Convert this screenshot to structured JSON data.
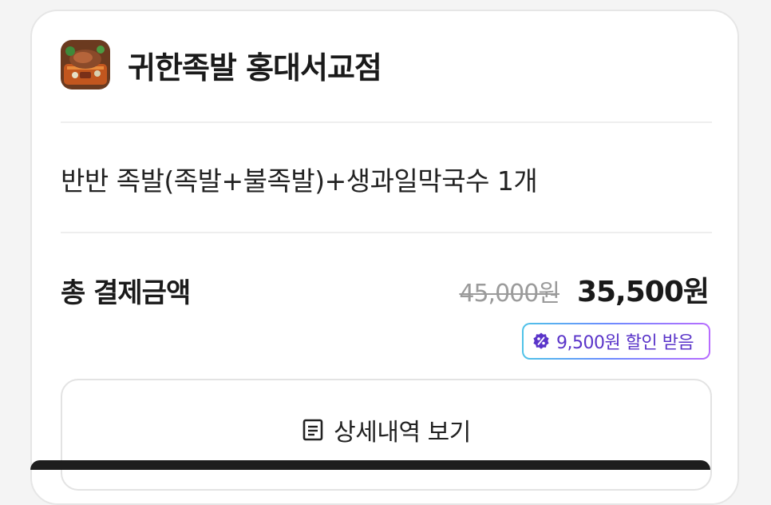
{
  "store": {
    "name": "귀한족발 홍대서교점",
    "thumbnail_icon": "store-food-photo"
  },
  "order": {
    "menu_summary": "반반 족발(족발+불족발)+생과일막국수 1개"
  },
  "payment": {
    "total_label": "총 결제금액",
    "original_price": "45,000원",
    "final_price": "35,500원",
    "discount_badge": "9,500원 할인 받음",
    "discount_icon": "coupon-percent-icon"
  },
  "actions": {
    "detail_label": "상세내역 보기",
    "detail_icon": "receipt-icon"
  },
  "colors": {
    "badge_text": "#5a34c9",
    "badge_gradient_start": "#4fc3e8",
    "badge_gradient_end": "#b86cff",
    "strikethrough": "#9b9b9b"
  }
}
